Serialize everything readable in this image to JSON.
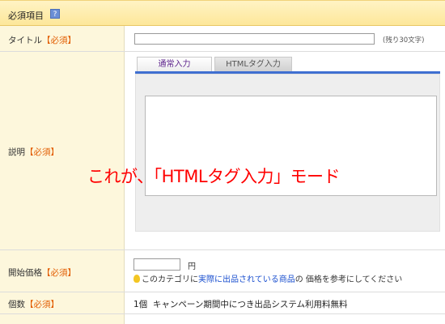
{
  "section_header": {
    "title": "必須項目",
    "help_icon_label": "?"
  },
  "rows": {
    "title_row": {
      "label": "タイトル",
      "required": "【必須】",
      "input_value": "",
      "remaining": "(残り30文字)"
    },
    "description_row": {
      "label": "説明",
      "required": "【必須】",
      "tabs": [
        "通常入力",
        "HTMLタグ入力"
      ],
      "active_tab": "HTMLタグ入力"
    },
    "price_row": {
      "label": "開始価格",
      "required": "【必須】",
      "input_value": "",
      "unit": "円",
      "hint_prefix": "このカテゴリに",
      "hint_link": "実際に出品されている商品",
      "hint_suffix": "の 価格を参考にしてください"
    },
    "quantity_row": {
      "label": "個数",
      "required": "【必須】",
      "value": "1個",
      "note": "キャンペーン期間中につき出品システム利用料無料"
    }
  },
  "annotation": "これが、「HTMLタグ入力」モード",
  "colors": {
    "required": "#e25c00",
    "annotation": "#ff0000",
    "tab_underline": "#3f6fd1",
    "link": "#1a4fcf"
  },
  "icons": [
    "help-icon",
    "lightbulb-icon"
  ]
}
